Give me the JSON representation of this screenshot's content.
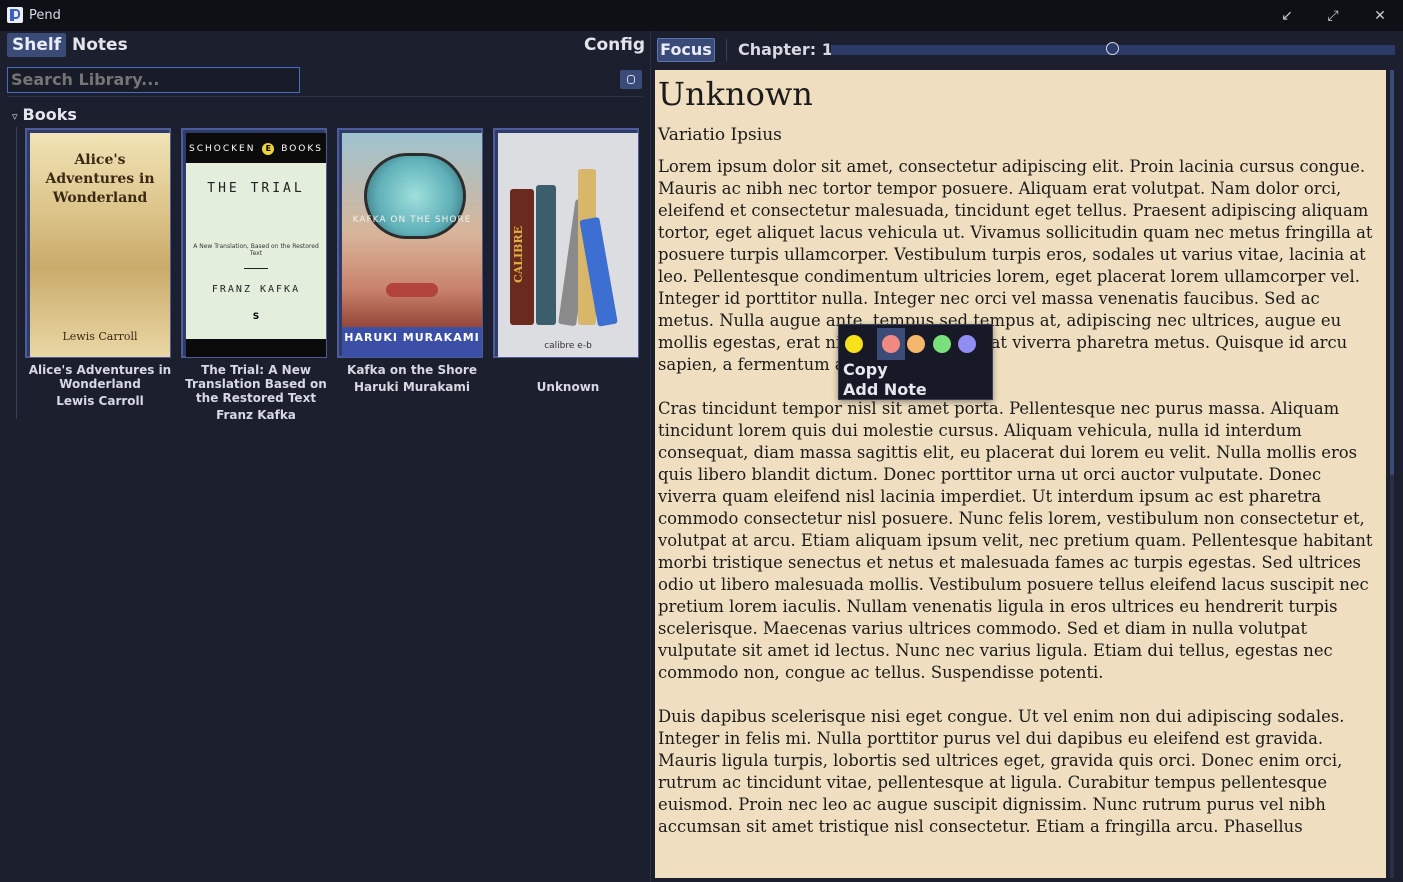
{
  "window": {
    "title": "Pend",
    "min_glyph": "↙",
    "max_glyph": "⤢",
    "close_glyph": "✕"
  },
  "left": {
    "tabs": {
      "shelf": "Shelf",
      "notes": "Notes",
      "config": "Config"
    },
    "search": {
      "placeholder": "Search Library..."
    },
    "section": {
      "title": "Books",
      "toggle": "▿"
    },
    "books": [
      {
        "title": "Alice's Adventures in Wonderland",
        "author": "Lewis Carroll",
        "cover_title": "Alice's Adventures in Wonderland",
        "cover_author": "Lewis Carroll"
      },
      {
        "title": "The Trial: A New Translation Based on the Restored Text",
        "author": "Franz Kafka",
        "cover_publisher": "SCHOCKEN",
        "cover_publisher_mark": "E",
        "cover_publisher_books": "BOOKS",
        "cover_title": "THE TRIAL",
        "cover_subtitle": "A New Translation, Based on the Restored Text",
        "cover_author": "FRANZ KAFKA",
        "cover_mark": "S"
      },
      {
        "title": "Kafka on the Shore",
        "author": "Haruki Murakami",
        "cover_title": "KAFKA ON THE SHORE",
        "cover_author": "HARUKI MURAKAMI"
      },
      {
        "title": "Unknown",
        "author": "",
        "cover_label": "CALIBRE",
        "cover_footer": "calibre e-b"
      }
    ]
  },
  "right": {
    "focus_label": "Focus",
    "chapter_label": "Chapter: 1",
    "chapter_progress": 0.5,
    "reader": {
      "title": "Unknown",
      "subtitle": "Variatio Ipsius",
      "paragraphs": [
        "Lorem ipsum dolor sit amet, consectetur adipiscing elit. Proin lacinia cursus congue. Mauris ac nibh nec tortor tempor posuere. Aliquam erat volutpat. Nam dolor orci, eleifend et consectetur malesuada, tincidunt eget tellus. Praesent adipiscing aliquam tortor, eget aliquet lacus vehicula ut. Vivamus sollicitudin quam nec metus fringilla at posuere turpis ullamcorper. Vestibulum turpis eros, sodales ut varius vitae, lacinia at leo. Pellentesque condimentum ultricies lorem, eget placerat lorem ullamcorper vel. Integer id porttitor nulla. Integer nec orci vel massa venenatis faucibus. Sed ac metus. Nulla augue ante, tempus sed tempus at, adipiscing nec ultrices, augue eu mollis egestas, erat nibh posuere diam, at viverra pharetra metus. Quisque id arcu sapien, a fermentum ante.",
        "Cras tincidunt tempor nisl sit amet porta. Pellentesque nec purus massa. Aliquam tincidunt lorem quis dui molestie cursus. Aliquam vehicula, nulla id interdum consequat, diam massa sagittis elit, eu placerat dui lorem eu velit. Nulla mollis eros quis libero blandit dictum. Donec porttitor urna ut orci auctor vulputate. Donec viverra quam eleifend nisl lacinia imperdiet. Ut interdum ipsum ac est pharetra commodo consectetur nisl posuere. Nunc felis lorem, vestibulum non consectetur et, volutpat at arcu. Etiam aliquam ipsum velit, nec pretium quam. Pellentesque habitant morbi tristique senectus et netus et malesuada fames ac turpis egestas. Sed ultrices odio ut libero malesuada mollis. Vestibulum posuere tellus eleifend lacus suscipit nec pretium lorem iaculis. Nullam venenatis ligula in eros ultrices eu hendrerit turpis scelerisque. Maecenas varius ultrices commodo. Sed et diam in nulla volutpat vulputate sit amet id lectus. Nunc nec varius ligula. Etiam dui tellus, egestas nec commodo non, congue ac tellus. Suspendisse potenti.",
        "Duis dapibus scelerisque nisi eget congue. Ut vel enim non dui adipiscing sodales. Integer in felis mi. Nulla porttitor purus vel dui dapibus eu eleifend est gravida. Mauris ligula turpis, lobortis sed ultrices eget, gravida quis orci. Donec enim orci, rutrum ac tincidunt vitae, pellentesque at ligula. Curabitur tempus pellentesque euismod. Proin nec leo ac augue suscipit dignissim. Nunc rutrum purus vel nibh accumsan sit amet tristique nisl consectetur. Etiam a fringilla arcu. Phasellus"
      ]
    }
  },
  "context_menu": {
    "colors": [
      "#f5e21b",
      "#f08a80",
      "#f4b66a",
      "#79e07d",
      "#8f8cf2"
    ],
    "selected_color_index": 1,
    "copy": "Copy",
    "add_note": "Add Note"
  }
}
